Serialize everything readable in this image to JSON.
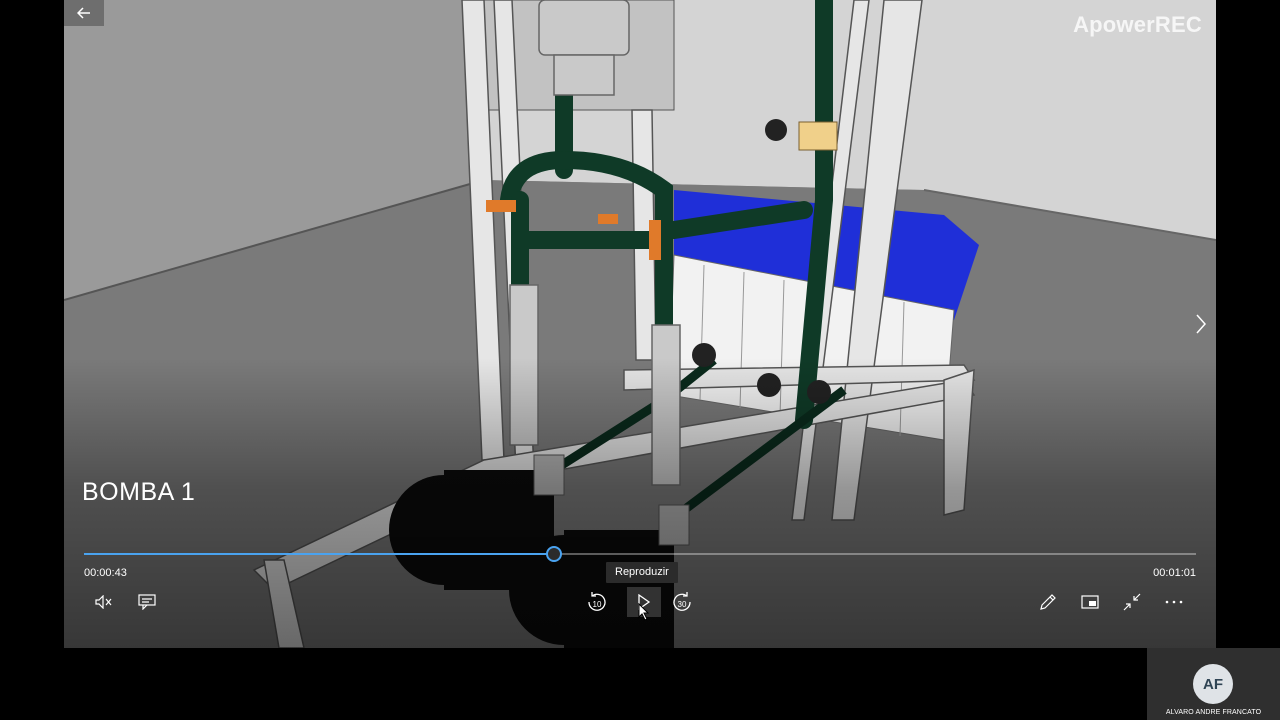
{
  "player": {
    "title": "BOMBA 1",
    "watermark": "ApowerREC",
    "current_time": "00:00:43",
    "duration": "00:01:01",
    "progress_fraction": 0.423,
    "tooltip": "Reproduzir",
    "skip_back_label": "10",
    "skip_forward_label": "30",
    "accent_color": "#4aa3f0"
  },
  "controls": {
    "left": [
      "mute-icon",
      "subtitles-icon"
    ],
    "center": [
      "skip-back-10-icon",
      "play-icon",
      "skip-forward-30-icon"
    ],
    "right": [
      "pencil-icon",
      "mini-view-icon",
      "exit-fullscreen-icon",
      "more-icon"
    ]
  },
  "participant": {
    "initials": "AF",
    "name": "ALVARO ANDRE FRANCATO"
  }
}
